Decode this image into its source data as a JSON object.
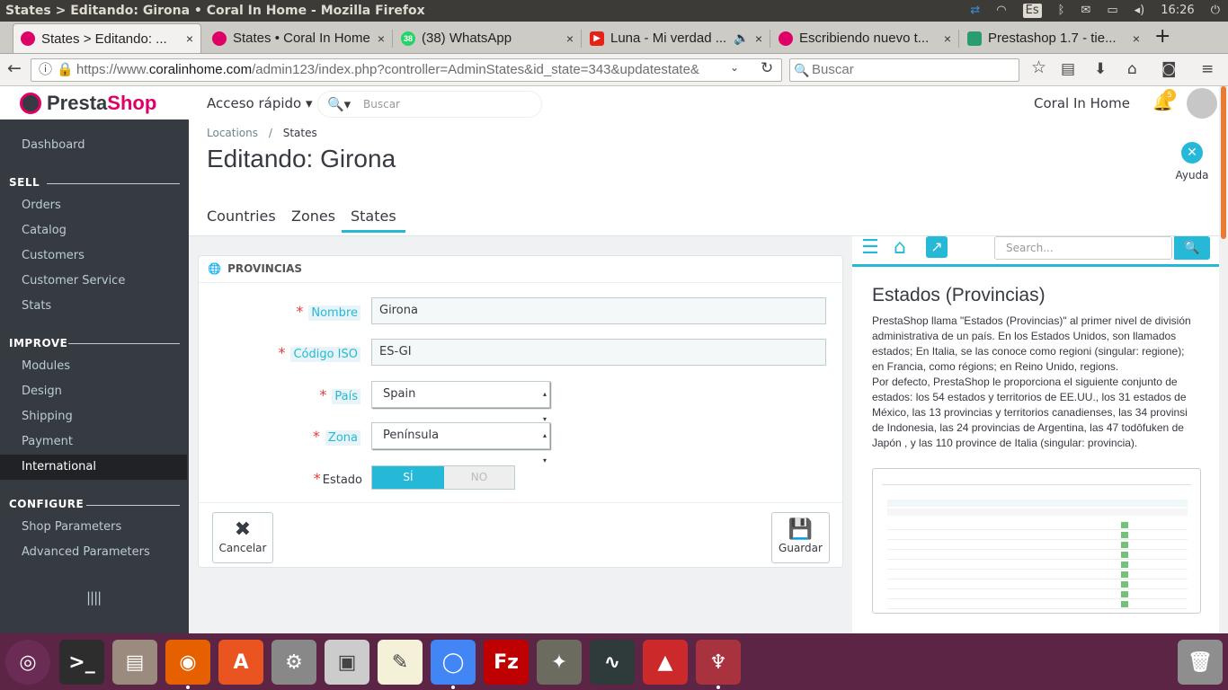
{
  "os": {
    "window_title": "States > Editando: Girona • Coral In Home - Mozilla Firefox",
    "lang_badge": "Es",
    "clock": "16:26"
  },
  "browser": {
    "tabs": [
      {
        "title": "States > Editando: ...",
        "color": "#df0067"
      },
      {
        "title": "States • Coral In Home",
        "color": "#df0067"
      },
      {
        "title": "(38) WhatsApp",
        "color": "#25d366",
        "badge": "38"
      },
      {
        "title": "Luna - Mi verdad ...",
        "color": "#e62117"
      },
      {
        "title": "Escribiendo nuevo t...",
        "color": "#df0067"
      },
      {
        "title": "Prestashop 1.7 - tie...",
        "color": "#2a9d6f"
      }
    ],
    "close_glyph": "×",
    "new_tab": "+",
    "url_prefix": "https://www.",
    "url_host": "coralinhome.com",
    "url_path": "/admin123/index.php?controller=AdminStates&id_state=343&updatestate&",
    "search_placeholder": "Buscar"
  },
  "sidebar": {
    "logo_a": "Presta",
    "logo_b": "Shop",
    "items": {
      "dashboard": "Dashboard",
      "sell": "SELL",
      "orders": "Orders",
      "catalog": "Catalog",
      "customers": "Customers",
      "customer_service": "Customer Service",
      "stats": "Stats",
      "improve": "IMPROVE",
      "modules": "Modules",
      "design": "Design",
      "shipping": "Shipping",
      "payment": "Payment",
      "international": "International",
      "configure": "CONFIGURE",
      "shop_parameters": "Shop Parameters",
      "advanced_parameters": "Advanced Parameters"
    },
    "collapse_glyph": "||||"
  },
  "header": {
    "quick_access": "Acceso rápido ▾",
    "search_placeholder": "Buscar",
    "shop_name": "Coral In Home",
    "notifications": "5"
  },
  "toolbar": {
    "breadcrumb_parent": "Locations",
    "breadcrumb_sep": "/",
    "breadcrumb_current": "States",
    "title": "Editando: Girona",
    "help_label": "Ayuda",
    "tabs": {
      "countries": "Countries",
      "zones": "Zones",
      "states": "States"
    }
  },
  "form": {
    "panel_title": "PROVINCIAS",
    "required_mark": "*",
    "name_label": "Nombre",
    "name_value": "Girona",
    "iso_label": "Código ISO",
    "iso_value": "ES-GI",
    "country_label": "País",
    "country_value": "Spain",
    "zone_label": "Zona",
    "zone_value": "Península",
    "status_label": "Estado",
    "status_on": "SÍ",
    "status_off": "NO",
    "status_value": true,
    "cancel": "Cancelar",
    "save": "Guardar"
  },
  "help": {
    "search_placeholder": "Search...",
    "title": "Estados (Provincias)",
    "p1": "PrestaShop llama \"Estados (Provincias)\" al primer nivel de división administrativa de un país. En los Estados Unidos, son llamados estados; En Italia, se las conoce como regioni (singular: regione); en Francia, como régions; en Reino Unido, regions.",
    "p2": "Por defecto, PrestaShop le proporciona el siguiente conjunto de estados: los 54 estados y territorios de EE.UU., los 31 estados de México, las 13 provincias y territorios canadienses, las 34 provinsi de Indonesia, las 24 provincias de Argentina, las 47 todōfuken de Japón , y las 110 province de Italia (singular: provincia)."
  },
  "colors": {
    "accent": "#25b9d7",
    "sidebar_bg": "#363a41",
    "brand_pink": "#df0067",
    "taskbar": "#5c2445"
  }
}
